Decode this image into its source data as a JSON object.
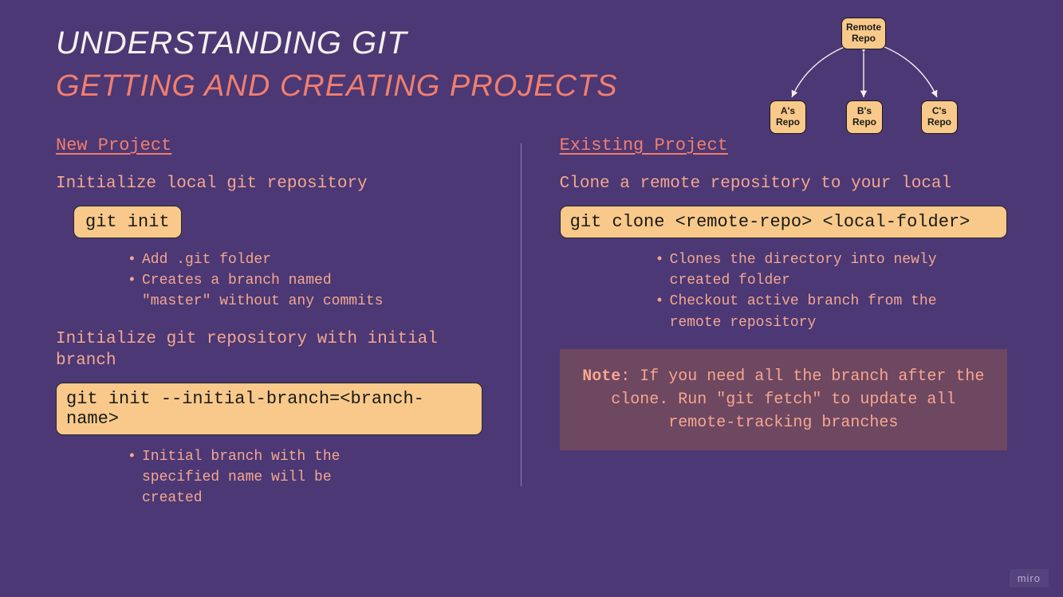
{
  "header": {
    "title1": "Understanding Git",
    "title2": "Getting and Creating Projects"
  },
  "diagram": {
    "remote": "Remote\nRepo",
    "a": "A's\nRepo",
    "b": "B's\nRepo",
    "c": "C's\nRepo"
  },
  "left": {
    "section_title": "New Project",
    "block1": {
      "desc": "Initialize local git repository",
      "code": "git init",
      "bullets": [
        "Add .git folder",
        "Creates a branch named \"master\" without any commits"
      ]
    },
    "block2": {
      "desc": "Initialize git repository with initial branch",
      "code": "git init --initial-branch=<branch-name>",
      "bullets": [
        "Initial branch with the specified name will be created"
      ]
    }
  },
  "right": {
    "section_title": "Existing Project",
    "block1": {
      "desc": "Clone a remote repository to your local",
      "code": "git clone <remote-repo> <local-folder>",
      "bullets": [
        "Clones the directory into newly created folder",
        "Checkout active branch from the remote repository"
      ]
    },
    "note_label": "Note",
    "note_body": ": If you need all the branch after the clone. Run \"git fetch\" to update all remote-tracking branches"
  },
  "watermark": "miro"
}
